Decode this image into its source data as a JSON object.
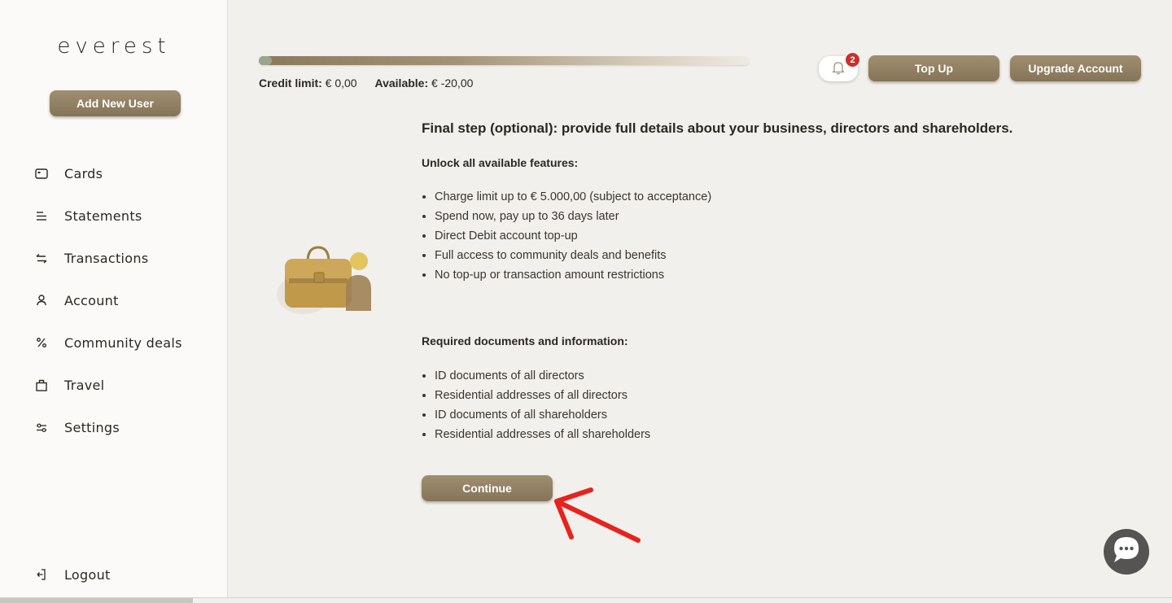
{
  "brand": {
    "logo": "everest"
  },
  "sidebar": {
    "add_user_label": "Add New User",
    "items": [
      {
        "label": "Cards",
        "icon": "card-icon"
      },
      {
        "label": "Statements",
        "icon": "statements-icon"
      },
      {
        "label": "Transactions",
        "icon": "transactions-icon"
      },
      {
        "label": "Account",
        "icon": "account-icon"
      },
      {
        "label": "Community deals",
        "icon": "percent-icon"
      },
      {
        "label": "Travel",
        "icon": "travel-icon"
      },
      {
        "label": "Settings",
        "icon": "settings-icon"
      }
    ],
    "logout_label": "Logout"
  },
  "header": {
    "credit_limit_label": "Credit limit:",
    "credit_limit_value": "€ 0,00",
    "available_label": "Available:",
    "available_value": "€ -20,00",
    "notification_count": "2",
    "topup_label": "Top Up",
    "upgrade_label": "Upgrade Account"
  },
  "content": {
    "heading": "Final step (optional): provide full details about your business, directors and shareholders.",
    "features_title": "Unlock all available features:",
    "features": [
      "Charge limit up to € 5.000,00 (subject to acceptance)",
      "Spend now, pay up to 36 days later",
      "Direct Debit account top-up",
      "Full access to community deals and benefits",
      "No top-up or transaction amount restrictions"
    ],
    "documents_title": "Required documents and information:",
    "documents": [
      "ID documents of all directors",
      "Residential addresses of all directors",
      "ID documents of all shareholders",
      "Residential addresses of all shareholders"
    ],
    "continue_label": "Continue"
  },
  "colors": {
    "accent": "#8f7e61",
    "badge": "#c8302c",
    "annotation_arrow": "#e8221c",
    "chat": "#555452"
  }
}
